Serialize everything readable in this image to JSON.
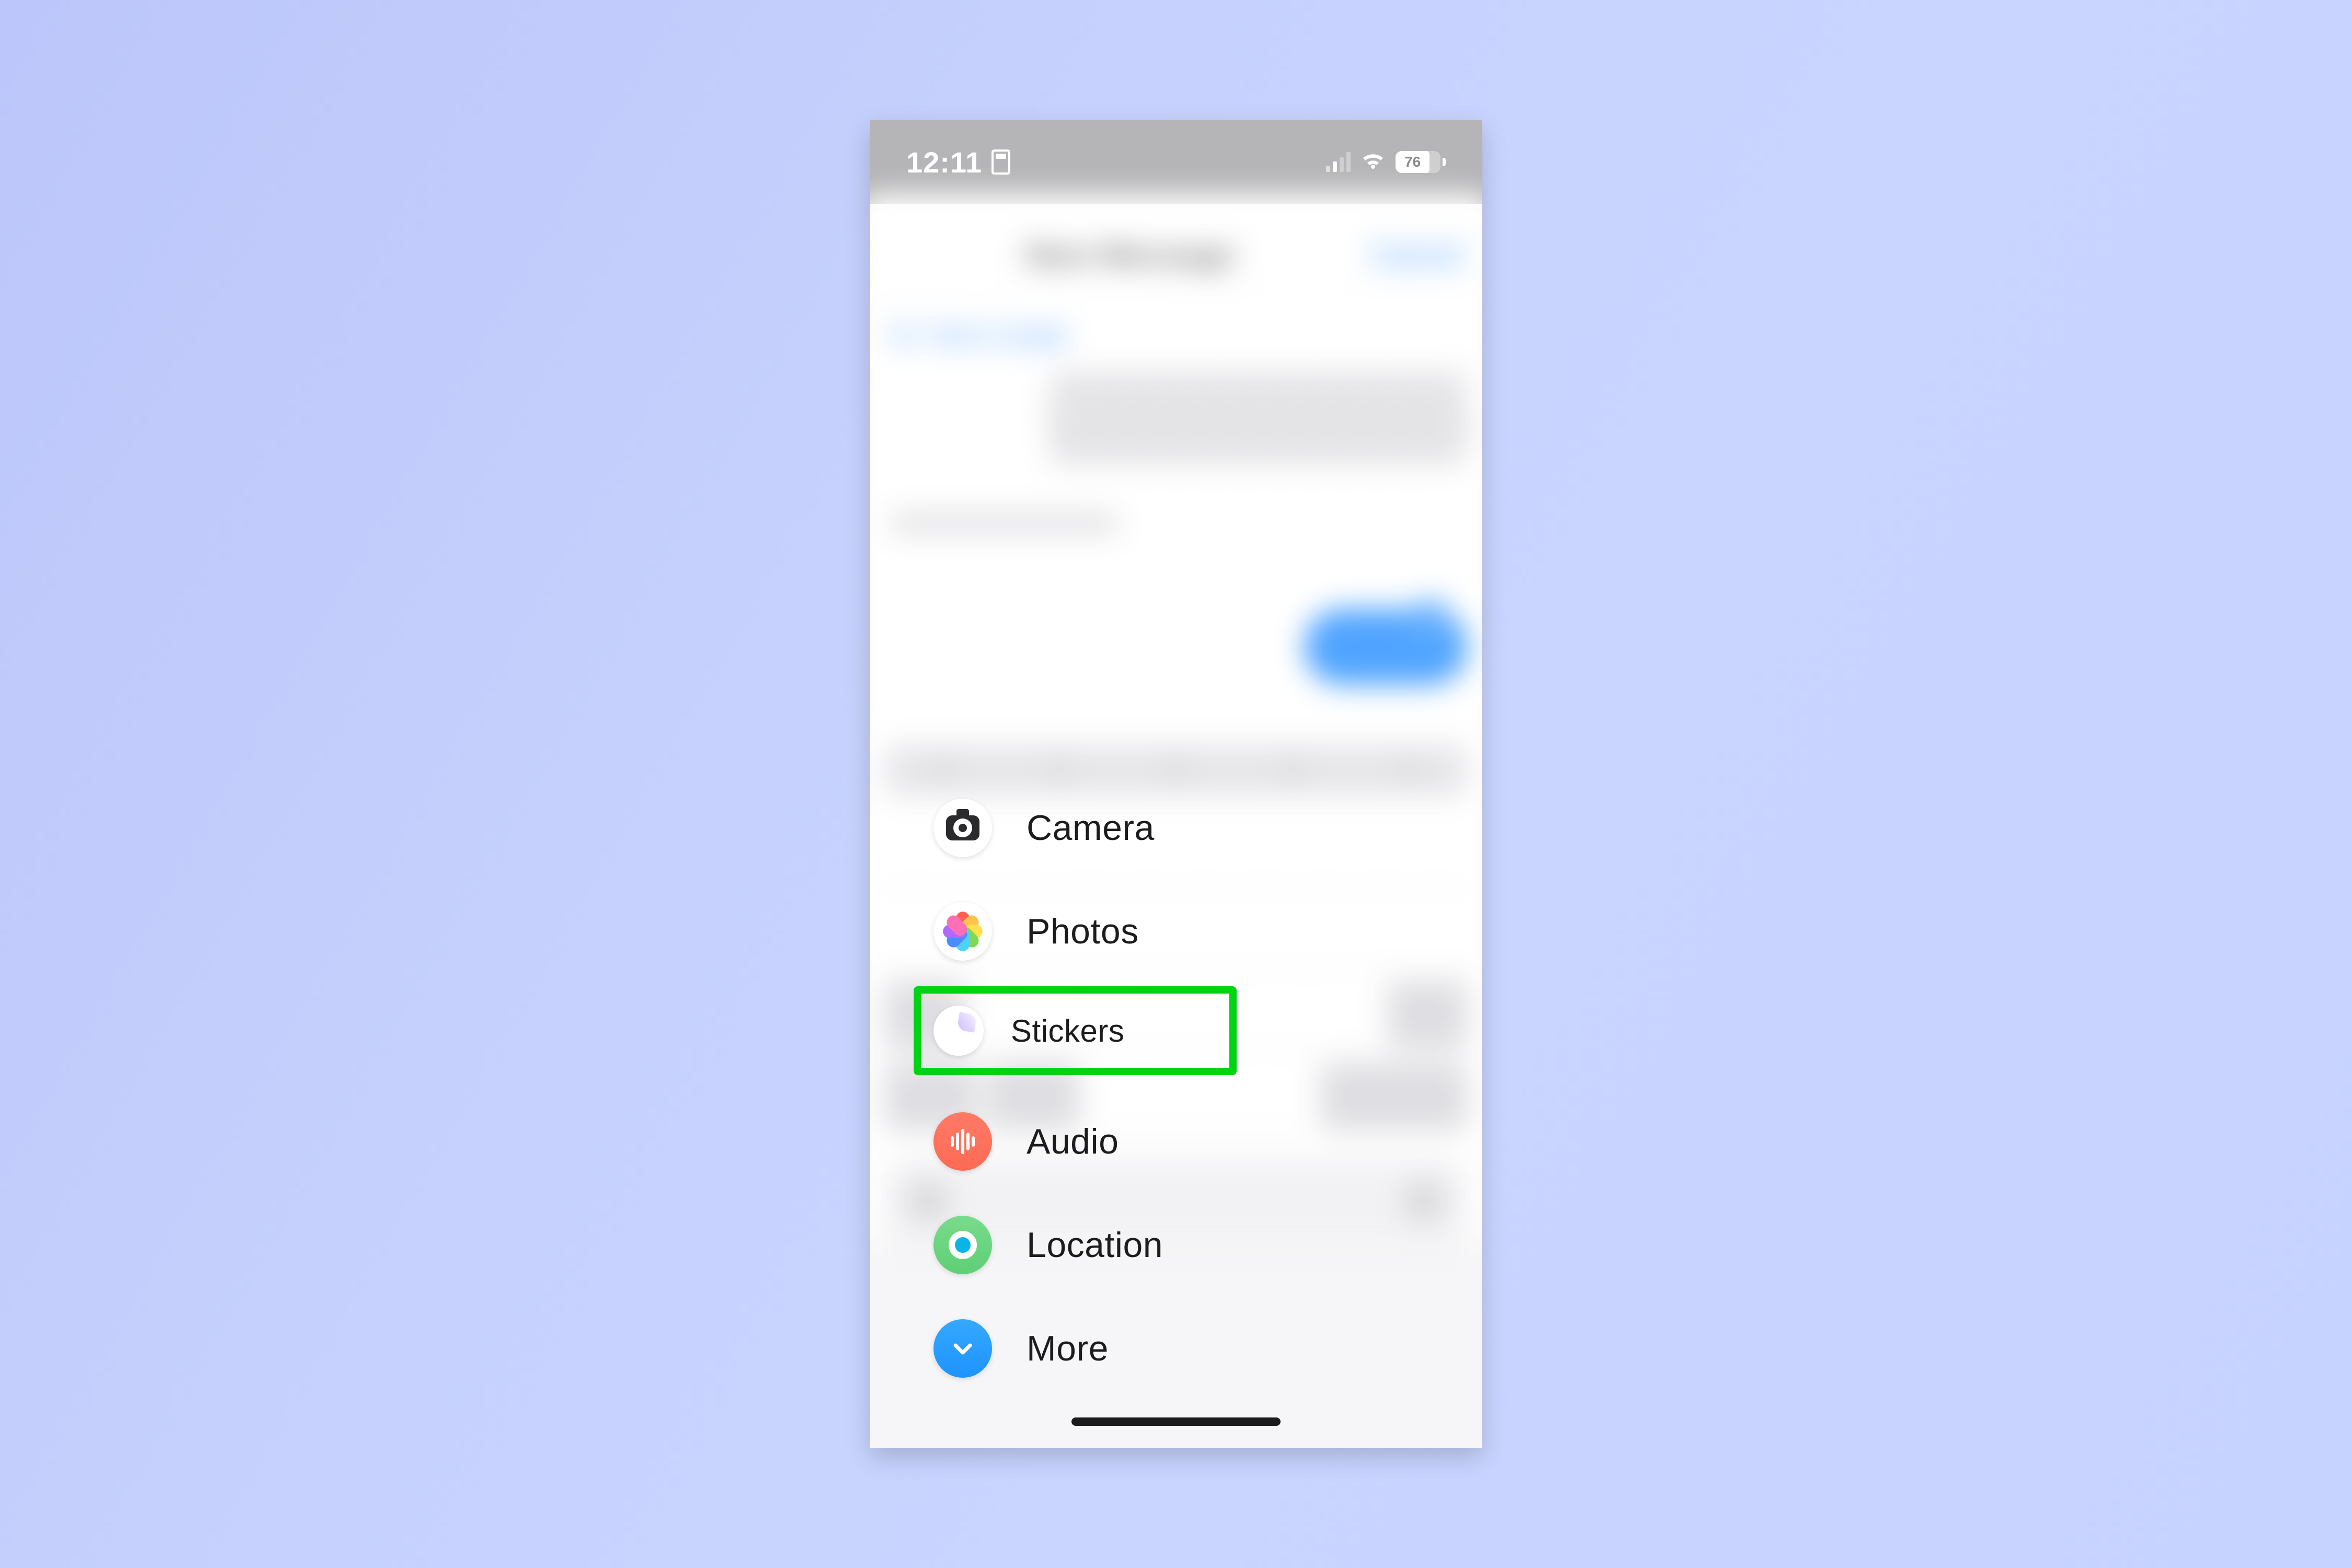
{
  "status": {
    "time": "12:11",
    "battery_pct": "76"
  },
  "blurred_header": {
    "title": "New Message",
    "action": "Cancel",
    "to_prefix": "To: Tom's Guide"
  },
  "menu": {
    "camera": "Camera",
    "photos": "Photos",
    "stickers": "Stickers",
    "audio": "Audio",
    "location": "Location",
    "more": "More"
  },
  "highlighted": "stickers"
}
